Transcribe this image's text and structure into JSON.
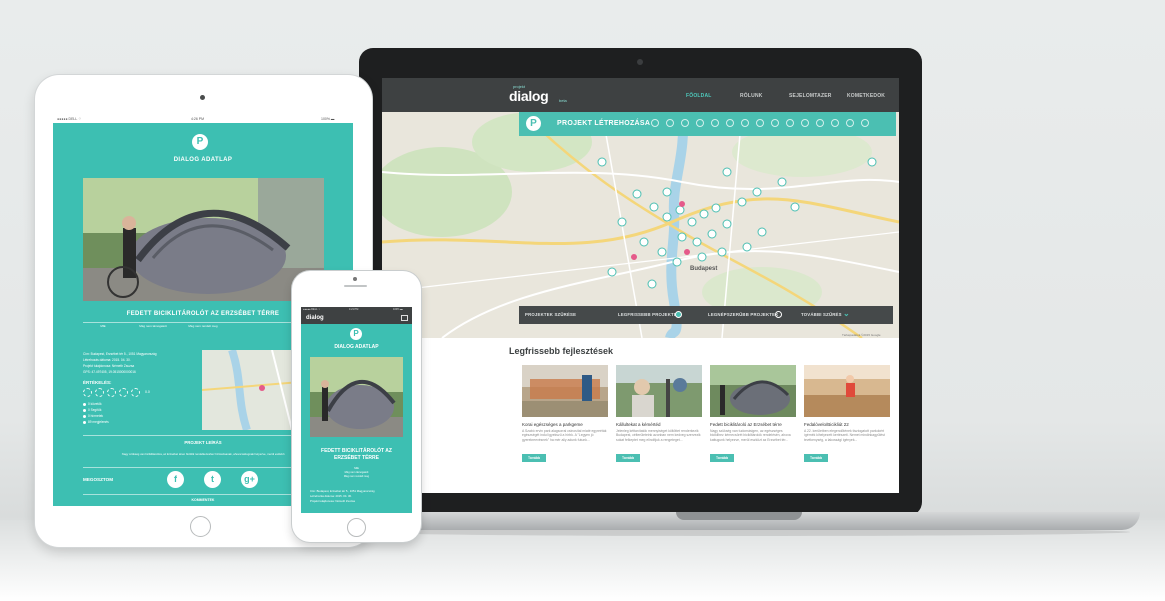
{
  "laptop": {
    "logo": "dialog",
    "logo_sup": "projekt",
    "logo_sub": "beta",
    "nav": [
      "FŐOLDAL",
      "RÓLUNK",
      "SEJELOMTAZER",
      "KOMETKEDOK"
    ],
    "banner_title": "PROJEKT LÉTREHOZÁSA",
    "map_city": "Budapest",
    "filter": {
      "label": "PROJEKTEK SZŰRÉSE",
      "opt1": "LEGFRISSEBB PROJEKTEK",
      "opt2": "LEGNÉPSZERŰBB PROJEKTEK",
      "more": "TOVÁBBI SZŰRÉS"
    },
    "map_credit": "Térképadatok ©2015 Google",
    "section_title": "Legfrissebb fejlesztések",
    "cards": [
      {
        "title": "Korai egészséges a parkgeme",
        "desc": "A Szabó ervin park alagsorral csinosítal miaté egyreéták egészségét indul igyekszű a hírbk. A \"Legyen jó gyerekreevésnek\" ha mér aliy adunk futunk...",
        "button": "Tovább"
      },
      {
        "title": "Kállultekat a kémértéd",
        "desc": "Jelenleg kéttanítatók mennyiséget költöttet renderkezik Budapest, célterületeink azonban nem kedveg szervezik sokat felkeptet meg elindítjuk a rengeteget...",
        "button": "Tovább"
      },
      {
        "title": "Fedett biciklitároló az Erzsébet térre",
        "desc": "Nagy szükség van tudomásigen, az egészséges biciklihez kérnecsörét biciklitárolók rendelésén, ahova kattugunk helyezve, merül eszközt az Erzsébet tér...",
        "button": "Tovább"
      },
      {
        "title": "Fedalóvelo/Bicikliút 22",
        "desc": "A 22. kerületben elegendőtének tisztogatott parkokért ígérnék kihelyezett kertészeti. Nemet mindinkagyűlést tevékenység, a lakossági igények...",
        "button": "Tovább"
      }
    ]
  },
  "tablet": {
    "status_left": "●●●●● DELL ⌔",
    "status_time": "4:26 PM",
    "status_right": "100% ▬",
    "badge": "P",
    "heading": "DIALOG ADATLAP",
    "subtitle": "FEDETT BICIKLITÁROLÓT AZ ERZSÉBET TÉRRE",
    "stats": [
      "MIE",
      "Még nem támogatott",
      "Még nem rendelt meg"
    ],
    "info_lines": [
      "Cím: Budapest, Erzsébet tér 5., 1051 Magyarország",
      "Létrehozás dátuma: 2015. 04. 30.",
      "Projekt tulajdonosa: Németh Zsuzsa",
      "GPS: 47.497405, 19.0515000000016"
    ],
    "rating_label": "ÉRTÉKELÉS:",
    "rating_value": "0.0",
    "legend": [
      "0 követők",
      "0 Segítők",
      "0 hírmetek",
      "89 megjelenés"
    ],
    "desc_heading": "PROJEKT LEÍRÁS",
    "desc_text": "Nagy szükség van biciklitárolóra, az Erzsébet téren biciklik rendelkezéshez biztosítsanak, ahova kattugnak helyezve, merül eszközt.",
    "share_label": "MEGOSZTOM",
    "social": [
      "f",
      "t",
      "g+"
    ],
    "comments_label": "KOMMENTEK"
  },
  "phone": {
    "status_left": "●●●●● DELL ⌔",
    "status_time": "4:21 PM",
    "status_right": "100% ▬",
    "logo": "dialog",
    "badge": "P",
    "heading": "DIALOG ADATLAP",
    "subtitle": "FEDETT BICIKLITÁROLÓT AZ ERZSÉBET TÉRRE",
    "stats": [
      "MIE",
      "Még nem támogatott",
      "Még nem rendelt meg"
    ],
    "info_lines": [
      "Cím: Budapest, Erzsébet tér 5., 1051 Magyarország",
      "Létrehozás dátuma: 2015. 04. 30.",
      "Projekt tulajdonosa: Németh Zsuzsa"
    ]
  }
}
